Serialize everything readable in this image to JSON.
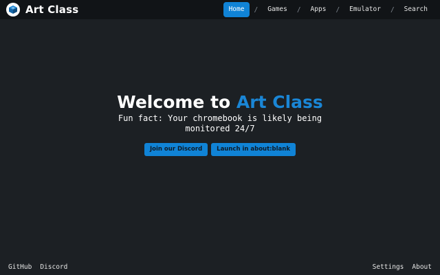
{
  "brand": {
    "name": "Art Class",
    "logo_icon": "cube-icon"
  },
  "nav": {
    "items": [
      {
        "label": "Home",
        "active": true
      },
      {
        "label": "Games",
        "active": false
      },
      {
        "label": "Apps",
        "active": false
      },
      {
        "label": "Emulator",
        "active": false
      },
      {
        "label": "Search",
        "active": false
      }
    ],
    "separator": "/"
  },
  "hero": {
    "title_prefix": "Welcome to ",
    "title_accent": "Art Class",
    "subtitle": "Fun fact: Your chromebook is likely being monitored 24/7",
    "buttons": [
      {
        "label": "Join our Discord"
      },
      {
        "label": "Launch in about:blank"
      }
    ]
  },
  "footer": {
    "left": [
      {
        "label": "GitHub"
      },
      {
        "label": "Discord"
      }
    ],
    "right": [
      {
        "label": "Settings"
      },
      {
        "label": "About"
      }
    ]
  },
  "colors": {
    "background": "#1c2024",
    "topbar": "#111417",
    "accent": "#1083d6",
    "text": "#ffffff"
  }
}
